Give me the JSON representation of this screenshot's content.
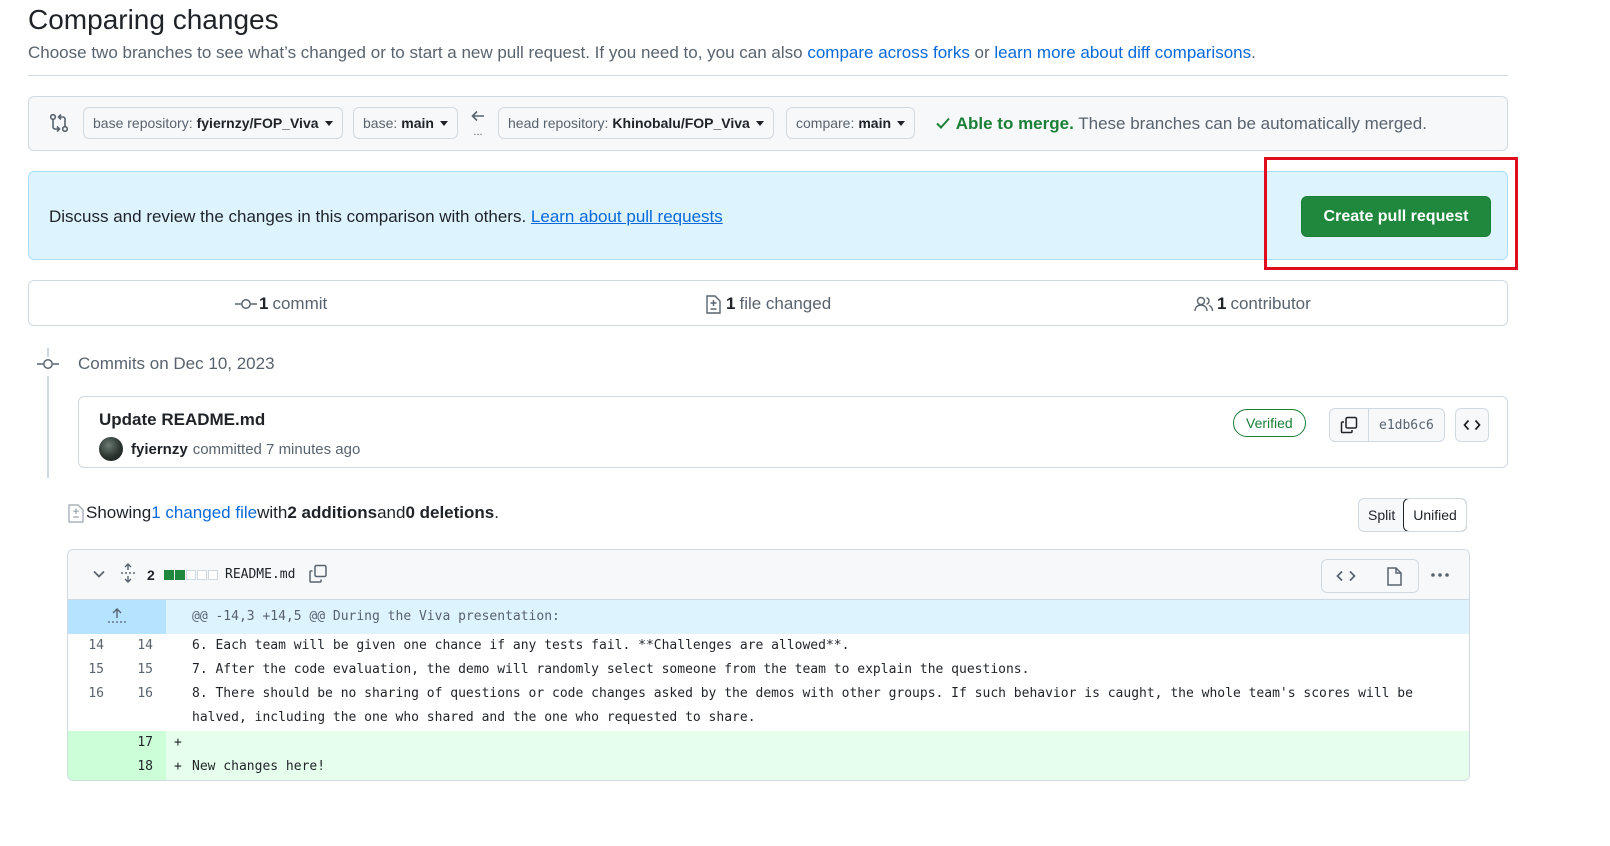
{
  "header": {
    "title": "Comparing changes",
    "subtitle_prefix": "Choose two branches to see what’s changed or to start a new pull request. If you need to, you can also ",
    "compare_forks_link": "compare across forks",
    "or_text": " or ",
    "learn_diff_link": "learn more about diff comparisons",
    "subtitle_suffix": "."
  },
  "range_editor": {
    "base_repo_label": "base repository:",
    "base_repo_value": "fyiernzy/FOP_Viva",
    "base_label": "base:",
    "base_value": "main",
    "swap_dots": "...",
    "head_repo_label": "head repository:",
    "head_repo_value": "Khinobalu/FOP_Viva",
    "compare_label": "compare:",
    "compare_value": "main",
    "merge_ok": "Able to merge.",
    "merge_text": " These branches can be automatically merged."
  },
  "blankslate": {
    "text": "Discuss and review the changes in this comparison with others. ",
    "link": "Learn about pull requests",
    "button": "Create pull request"
  },
  "summary": {
    "commits_count": "1",
    "commits_label": "commit",
    "files_count": "1",
    "files_label": "file changed",
    "contributors_count": "1",
    "contributors_label": "contributor"
  },
  "commits": {
    "heading": "Commits on Dec 10, 2023",
    "items": [
      {
        "title": "Update README.md",
        "author": "fyiernzy",
        "meta": "committed 7 minutes ago",
        "badge": "Verified",
        "sha": "e1db6c6"
      }
    ]
  },
  "toc": {
    "showing": "Showing ",
    "changed_link": "1 changed file",
    "with": " with ",
    "additions": "2 additions",
    "and": " and ",
    "deletions": "0 deletions",
    "period": ".",
    "split": "Split",
    "unified": "Unified"
  },
  "file": {
    "count": "2",
    "name": "README.md",
    "diffstat": {
      "additions": 2,
      "deletions": 0
    },
    "hunk": "@@ -14,3 +14,5 @@ During the Viva presentation:",
    "lines": [
      {
        "old": "14",
        "new": "14",
        "text": "6. Each team will be given one chance if any tests fail. **Challenges are allowed**."
      },
      {
        "old": "15",
        "new": "15",
        "text": "7. After the code evaluation, the demo will randomly select someone from the team to explain the questions."
      },
      {
        "old": "16",
        "new": "16",
        "text": "8. There should be no sharing of questions or code changes asked by the demos with other groups. If such behavior is caught, the whole team's scores will be",
        "text2": "halved, including the one who shared and the one who requested to share."
      },
      {
        "old": "",
        "new": "17",
        "marker": "+",
        "text": ""
      },
      {
        "old": "",
        "new": "18",
        "marker": "+",
        "text": "New changes here!"
      }
    ]
  },
  "colors": {
    "accent": "#0969da",
    "success": "#1f883d",
    "highlight": "#e00d1f"
  }
}
